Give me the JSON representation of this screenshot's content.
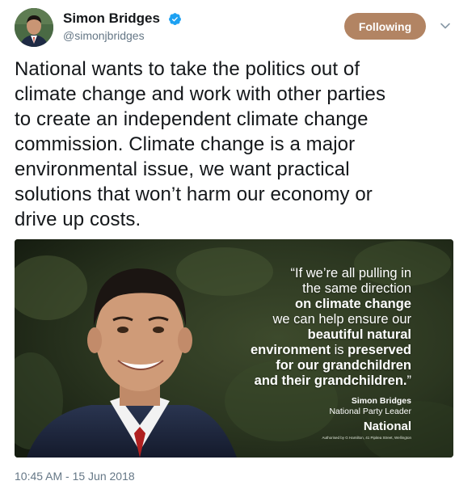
{
  "user": {
    "display_name": "Simon Bridges",
    "handle": "@simonjbridges",
    "verified": true,
    "avatar_icon": "profile-photo"
  },
  "actions": {
    "follow_label": "Following",
    "follow_color": "#b28463",
    "more_icon": "chevron-down-icon"
  },
  "tweet": {
    "text": "National wants to take the politics out of\nclimate change and work with other parties\nto create an independent climate change\ncommission. Climate change is a major\nenvironmental issue, we want practical\nsolutions that won’t harm our economy or\ndrive up costs."
  },
  "media": {
    "quote_lines": [
      {
        "text": "“If we’re all pulling in",
        "bold": false
      },
      {
        "text": "the same direction",
        "bold": false
      },
      {
        "text": "on climate change",
        "bold": true
      },
      {
        "text": "we can help ensure our",
        "bold": false
      },
      {
        "text": "beautiful natural",
        "bold": true
      },
      {
        "text": "environment",
        "bold": true,
        "rest": " is ",
        "rest_bold": false,
        "tail": "preserved",
        "tail_bold": true
      },
      {
        "text": "for our grandchildren",
        "bold": true
      },
      {
        "text": "and their grandchildren.",
        "bold": true,
        "rest": "”",
        "rest_bold": false
      }
    ],
    "attribution_name": "Simon Bridges",
    "attribution_title": "National Party Leader",
    "brand": "National",
    "authorised_text": "Authorised by G Hamilton, 41 Pipitea Street, Wellington"
  },
  "timestamp": "10:45 AM - 15 Jun 2018"
}
